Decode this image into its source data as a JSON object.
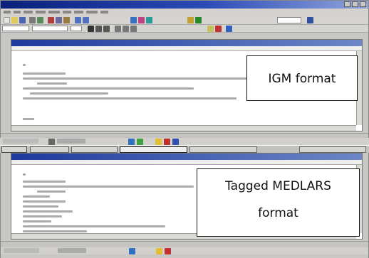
{
  "callouts": {
    "igm": "IGM format",
    "medlars_line1": "Tagged MEDLARS",
    "medlars_line2": "format"
  },
  "colors": {
    "titlebar": "#0a1f7a",
    "window_chrome": "#c9c7c3",
    "document": "#ffffff",
    "callout_border": "#111111"
  },
  "icons": [
    "minimize-icon",
    "maximize-icon",
    "close-icon",
    "toolbar-icons"
  ]
}
